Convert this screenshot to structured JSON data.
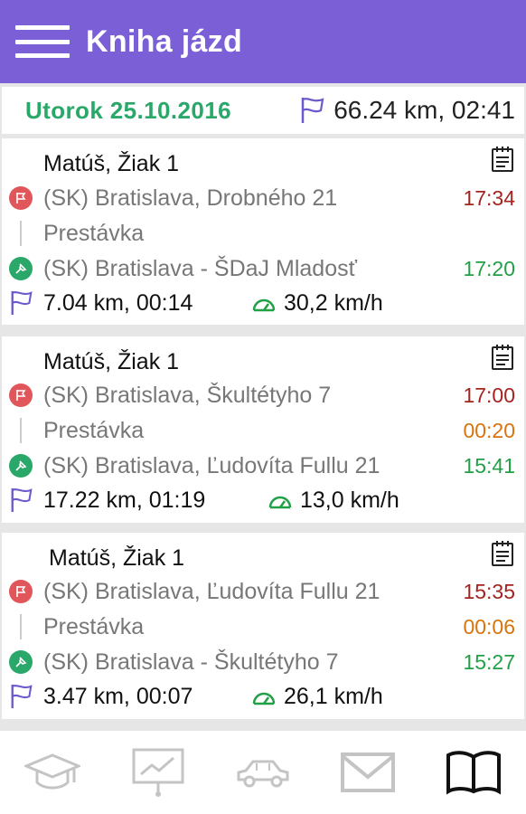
{
  "app_bar": {
    "title": "Kniha jázd"
  },
  "day": {
    "date_label": "Utorok 25.10.2016",
    "summary": "66.24 km, 02:41"
  },
  "trips": [
    {
      "name": "Matúš, Žiak 1",
      "end_location": "(SK) Bratislava, Drobného 21",
      "end_time": "17:34",
      "pause_label": "Prestávka",
      "pause_time": "",
      "start_location": "(SK) Bratislava - ŠDaJ Mladosť",
      "start_time": "17:20",
      "distance_duration": "7.04 km, 00:14",
      "avg_speed": "30,2 km/h"
    },
    {
      "name": "Matúš, Žiak 1",
      "end_location": "(SK) Bratislava, Škultétyho 7",
      "end_time": "17:00",
      "pause_label": "Prestávka",
      "pause_time": "00:20",
      "start_location": "(SK) Bratislava, Ľudovíta Fullu 21",
      "start_time": "15:41",
      "distance_duration": "17.22 km, 01:19",
      "avg_speed": "13,0 km/h"
    },
    {
      "name": "Matúš, Žiak 1",
      "end_location": "(SK) Bratislava, Ľudovíta Fullu 21",
      "end_time": "15:35",
      "pause_label": "Prestávka",
      "pause_time": "00:06",
      "start_location": "(SK) Bratislava - Škultétyho 7",
      "start_time": "15:27",
      "distance_duration": "3.47 km, 00:07",
      "avg_speed": "26,1 km/h"
    }
  ],
  "bottom_nav": [
    {
      "icon": "graduation-cap-icon",
      "active": false
    },
    {
      "icon": "presentation-chart-icon",
      "active": false
    },
    {
      "icon": "car-icon",
      "active": false
    },
    {
      "icon": "mail-icon",
      "active": false
    },
    {
      "icon": "book-icon",
      "active": true
    }
  ],
  "colors": {
    "app_bar": "#7b5fd6",
    "date_green": "#2aa86a",
    "end_time_red": "#a3241f",
    "start_time_green": "#22a046",
    "pause_orange": "#d9730d",
    "flag_purple": "#6a5acd"
  }
}
